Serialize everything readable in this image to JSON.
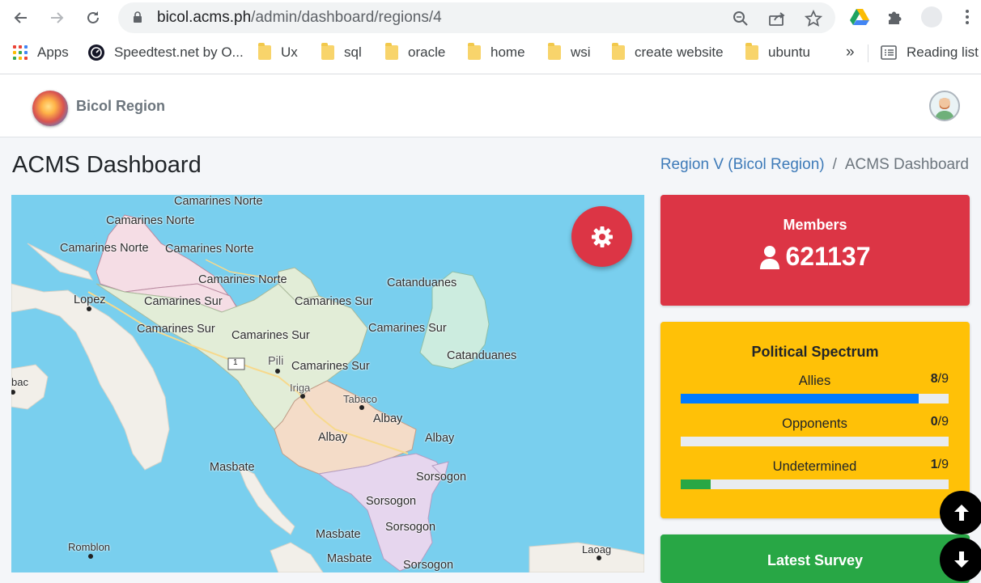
{
  "browser": {
    "url_host": "bicol.acms.ph",
    "url_path": "/admin/dashboard/regions/4",
    "bookmarks": [
      {
        "label": "Apps"
      },
      {
        "label": "Speedtest.net by O..."
      },
      {
        "label": "Ux"
      },
      {
        "label": "sql"
      },
      {
        "label": "oracle"
      },
      {
        "label": "home"
      },
      {
        "label": "wsi"
      },
      {
        "label": "create website"
      },
      {
        "label": "ubuntu"
      }
    ],
    "overflow_label": "»",
    "reading_list_label": "Reading list"
  },
  "header": {
    "brand_name": "Bicol Region"
  },
  "page": {
    "title": "ACMS Dashboard",
    "breadcrumb": {
      "parent": "Region V (Bicol Region)",
      "separator": "/",
      "current": "ACMS Dashboard"
    }
  },
  "map": {
    "labels": [
      {
        "text": "Camarines Norte"
      },
      {
        "text": "Camarines Norte"
      },
      {
        "text": "Camarines Norte"
      },
      {
        "text": "Camarines Norte"
      },
      {
        "text": "Camarines Norte"
      },
      {
        "text": "Lopez"
      },
      {
        "text": "Camarines Sur"
      },
      {
        "text": "Camarines Sur"
      },
      {
        "text": "Camarines Sur"
      },
      {
        "text": "Camarines Sur"
      },
      {
        "text": "Camarines Sur"
      },
      {
        "text": "Camarines Sur"
      },
      {
        "text": "Catanduanes"
      },
      {
        "text": "Catanduanes"
      },
      {
        "text": "Pili"
      },
      {
        "text": "Iriga"
      },
      {
        "text": "Tabaco"
      },
      {
        "text": "Albay"
      },
      {
        "text": "Albay"
      },
      {
        "text": "Albay"
      },
      {
        "text": "Masbate"
      },
      {
        "text": "Sorsogon"
      },
      {
        "text": "Sorsogon"
      },
      {
        "text": "Sorsogon"
      },
      {
        "text": "Sorsogon"
      },
      {
        "text": "Masbate"
      },
      {
        "text": "Masbate"
      },
      {
        "text": "Romblon"
      },
      {
        "text": "Laoag"
      },
      {
        "text": "bac"
      },
      {
        "text": "1"
      }
    ]
  },
  "cards": {
    "members": {
      "title": "Members",
      "count": "621137"
    },
    "spectrum": {
      "title": "Political Spectrum",
      "rows": [
        {
          "label": "Allies",
          "value": "8",
          "total": "/9",
          "fraction": 0.889,
          "color": "#007bff"
        },
        {
          "label": "Opponents",
          "value": "0",
          "total": "/9",
          "fraction": 0.0,
          "color": "#6c757d"
        },
        {
          "label": "Undetermined",
          "value": "1",
          "total": "/9",
          "fraction": 0.111,
          "color": "#28a745"
        }
      ]
    },
    "survey": {
      "title": "Latest Survey"
    }
  },
  "colors": {
    "members_bg": "#dc3545",
    "spectrum_bg": "#ffc107",
    "survey_bg": "#28a745",
    "link": "#3d7ab8",
    "sea": "#79cfee"
  }
}
